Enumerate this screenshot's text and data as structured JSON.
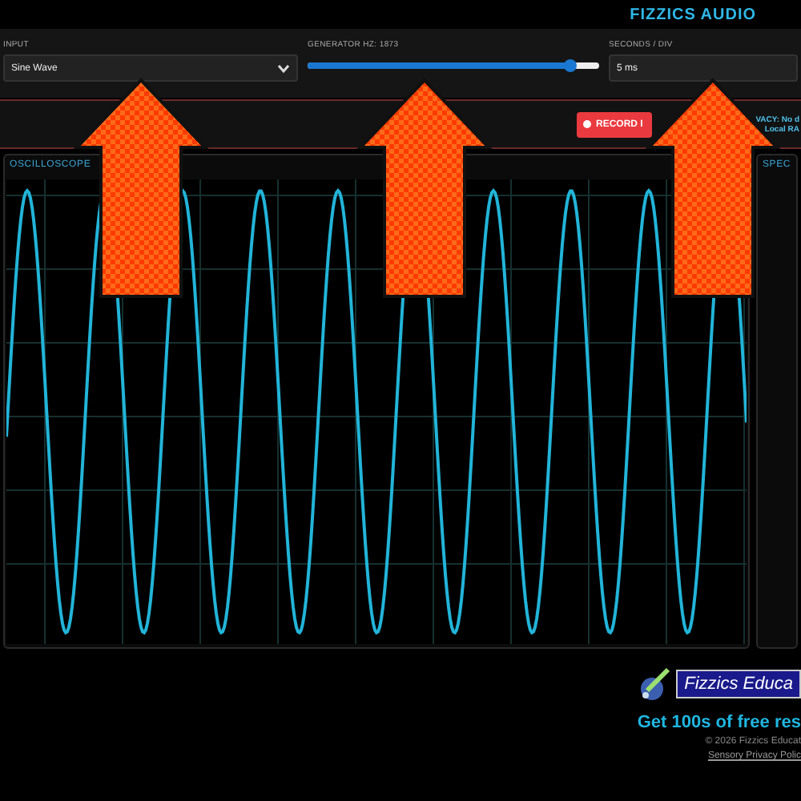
{
  "header": {
    "title": "FIZZICS AUDIO"
  },
  "controls": {
    "input": {
      "label": "INPUT",
      "value": "Sine Wave"
    },
    "generator": {
      "label": "GENERATOR HZ: 1873"
    },
    "seconds": {
      "label": "SECONDS / DIV",
      "value": "5 ms"
    }
  },
  "toolbar": {
    "record_button": "RECORD I",
    "privacy_lines": [
      "VACY: No d",
      "Local RA"
    ]
  },
  "panels": [
    {
      "title": "OSCILLOSCOPE"
    },
    {
      "title": "SPEC"
    }
  ],
  "footer": {
    "logo_text": "Fizzics Educa",
    "promo": "Get 100s of free res",
    "copyright": "© 2026 Fizzics Educat",
    "link": "Sensory Privacy Polic"
  }
}
